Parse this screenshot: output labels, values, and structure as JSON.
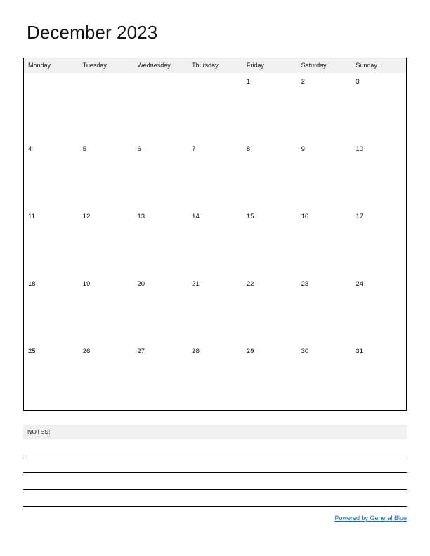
{
  "document": {
    "title": "December 2023",
    "month": "December",
    "year": "2023"
  },
  "calendar": {
    "weekdays": [
      {
        "label": "Monday"
      },
      {
        "label": "Tuesday"
      },
      {
        "label": "Wednesday"
      },
      {
        "label": "Thursday"
      },
      {
        "label": "Friday"
      },
      {
        "label": "Saturday"
      },
      {
        "label": "Sunday"
      }
    ],
    "weeks": [
      [
        {
          "day": ""
        },
        {
          "day": ""
        },
        {
          "day": ""
        },
        {
          "day": ""
        },
        {
          "day": "1"
        },
        {
          "day": "2"
        },
        {
          "day": "3"
        }
      ],
      [
        {
          "day": "4"
        },
        {
          "day": "5"
        },
        {
          "day": "6"
        },
        {
          "day": "7"
        },
        {
          "day": "8"
        },
        {
          "day": "9"
        },
        {
          "day": "10"
        }
      ],
      [
        {
          "day": "11"
        },
        {
          "day": "12"
        },
        {
          "day": "13"
        },
        {
          "day": "14"
        },
        {
          "day": "15"
        },
        {
          "day": "16"
        },
        {
          "day": "17"
        }
      ],
      [
        {
          "day": "18"
        },
        {
          "day": "19"
        },
        {
          "day": "20"
        },
        {
          "day": "21"
        },
        {
          "day": "22"
        },
        {
          "day": "23"
        },
        {
          "day": "24"
        }
      ],
      [
        {
          "day": "25"
        },
        {
          "day": "26"
        },
        {
          "day": "27"
        },
        {
          "day": "28"
        },
        {
          "day": "29"
        },
        {
          "day": "30"
        },
        {
          "day": "31"
        }
      ]
    ]
  },
  "notes": {
    "label": "NOTES:",
    "line_count": 4
  },
  "footer": {
    "link_text": "Powered by General Blue"
  },
  "colors": {
    "header_band": "#f0f0f0",
    "border": "#000000",
    "text": "#111111",
    "link": "#1a66cc",
    "page_background": "#ffffff"
  }
}
